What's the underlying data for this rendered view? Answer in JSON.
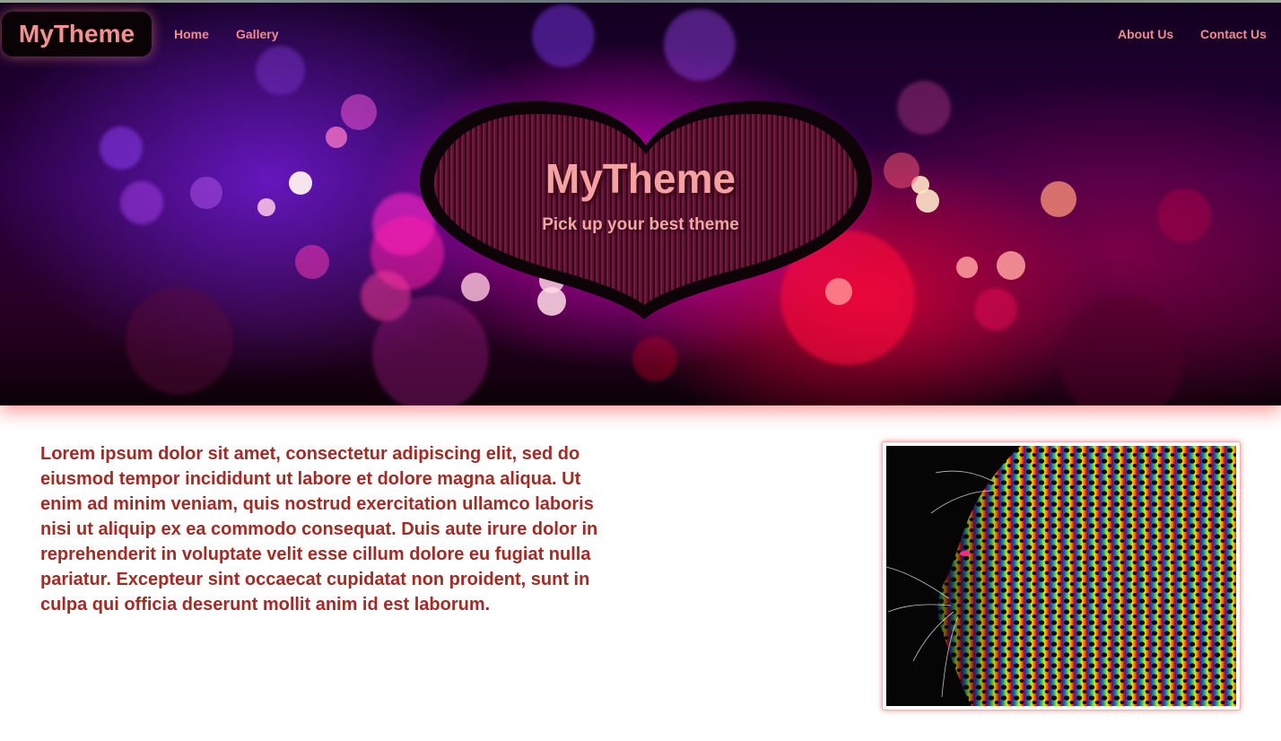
{
  "nav": {
    "brand": "MyTheme",
    "links_left": [
      "Home",
      "Gallery"
    ],
    "links_right": [
      "About Us",
      "Contact Us"
    ]
  },
  "hero": {
    "title": "MyTheme",
    "subtitle": "Pick up your best theme"
  },
  "content": {
    "paragraph": "Lorem ipsum dolor sit amet, consectetur adipiscing elit, sed do eiusmod tempor incididunt ut labore et dolore magna aliqua. Ut enim ad minim veniam, quis nostrud exercitation ullamco laboris nisi ut aliquip ex ea commodo consequat. Duis aute irure dolor in reprehenderit in voluptate velit esse cillum dolore eu fugiat nulla pariatur. Excepteur sint occaecat cupidatat non proident, sunt in culpa qui officia deserunt mollit anim id est laborum.",
    "image_subject": "rainbow-leopard-image"
  },
  "colors": {
    "brand_text": "#f59090",
    "nav_link": "#f28a8f",
    "body_text": "#a32b24",
    "hero_title": "#f4a1a1",
    "frame_glow": "#f05050"
  }
}
